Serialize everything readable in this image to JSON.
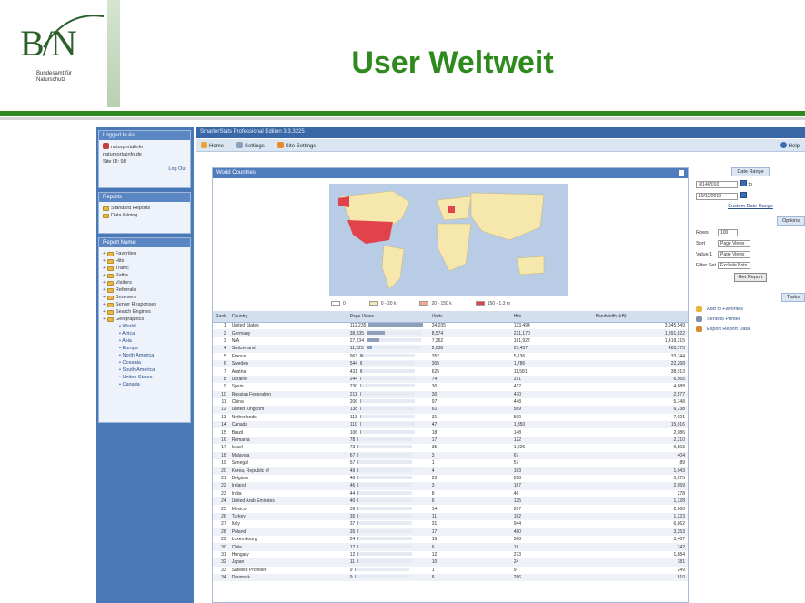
{
  "slide": {
    "title": "User Weltweit",
    "logo": {
      "mark": "B/N",
      "subtitle": "Bundesamt für Naturschutz"
    }
  },
  "app": {
    "window_title": "SmarterStats Professional Edition 3.3.3225",
    "toolbar": {
      "home": "Home",
      "settings": "Settings",
      "site_settings": "Site Settings",
      "help": "Help"
    }
  },
  "sidebar": {
    "login": {
      "title": "Logged In As",
      "user": "naturportalinfo",
      "domain": "naturportalinfo.de",
      "site": "Site ID: 98",
      "logout": "Log Out"
    },
    "reports": {
      "title": "Reports",
      "items": [
        "Standard Reports",
        "Data Mining"
      ]
    },
    "navigation": {
      "title": "Report Name",
      "folders": [
        "Favorites",
        "Hits",
        "Traffic",
        "Paths",
        "Visitors",
        "Referrals",
        "Browsers",
        "Server Responses",
        "Search Engines",
        "Geographics"
      ],
      "geo_items": [
        "World",
        "Africa",
        "Asia",
        "Europe",
        "North America",
        "Oceania",
        "South America",
        "United States",
        "Canada"
      ]
    }
  },
  "report": {
    "title": "World Countries",
    "legend": [
      "0",
      "0 - 20 k",
      "20 - 150 k",
      "150 - 1.3 m"
    ],
    "columns": [
      "Rank",
      "Country",
      "Page Views",
      "Visits",
      "Hits",
      "Bandwidth (kB)"
    ],
    "rows": [
      [
        "1",
        "United States",
        "112,235",
        "34,035",
        "133,494",
        "3,945,549"
      ],
      [
        "2",
        "Germany",
        "38,335",
        "8,574",
        "221,170",
        "1,891,622"
      ],
      [
        "3",
        "N/A",
        "27,234",
        "7,362",
        "181,927",
        "1,419,315"
      ],
      [
        "4",
        "Switzerland",
        "11,223",
        "2,038",
        "27,437",
        "483,773"
      ],
      [
        "5",
        "France",
        "963",
        "352",
        "5,136",
        "33,744"
      ],
      [
        "6",
        "Sweden",
        "544",
        "305",
        "1,786",
        "22,268"
      ],
      [
        "7",
        "Austria",
        "431",
        "625",
        "11,581",
        "38,913"
      ],
      [
        "8",
        "Ukraine",
        "244",
        "74",
        "291",
        "6,565"
      ],
      [
        "9",
        "Spain",
        "230",
        "30",
        "412",
        "4,888"
      ],
      [
        "10",
        "Russian Federation",
        "211",
        "30",
        "470",
        "2,577"
      ],
      [
        "11",
        "China",
        "206",
        "97",
        "448",
        "5,748"
      ],
      [
        "12",
        "United Kingdom",
        "138",
        "61",
        "569",
        "6,738"
      ],
      [
        "13",
        "Netherlands",
        "113",
        "31",
        "500",
        "7,021"
      ],
      [
        "14",
        "Canada",
        "110",
        "47",
        "1,350",
        "15,016"
      ],
      [
        "15",
        "Brazil",
        "106",
        "18",
        "148",
        "2,086"
      ],
      [
        "16",
        "Romania",
        "78",
        "17",
        "122",
        "2,310"
      ],
      [
        "17",
        "Israel",
        "73",
        "35",
        "1,226",
        "9,803"
      ],
      [
        "18",
        "Malaysia",
        "67",
        "3",
        "67",
        "404"
      ],
      [
        "19",
        "Senegal",
        "57",
        "1",
        "57",
        "89"
      ],
      [
        "20",
        "Korea, Republic of",
        "49",
        "4",
        "163",
        "1,043"
      ],
      [
        "21",
        "Belgium",
        "48",
        "23",
        "818",
        "5,675"
      ],
      [
        "22",
        "Ireland",
        "46",
        "3",
        "167",
        "2,659"
      ],
      [
        "23",
        "India",
        "44",
        "8",
        "46",
        "278"
      ],
      [
        "24",
        "United Arab Emirates",
        "40",
        "6",
        "125",
        "1,128"
      ],
      [
        "25",
        "Mexico",
        "39",
        "14",
        "207",
        "2,660"
      ],
      [
        "26",
        "Turkey",
        "35",
        "11",
        "162",
        "1,223"
      ],
      [
        "27",
        "Italy",
        "37",
        "31",
        "944",
        "6,862"
      ],
      [
        "28",
        "Poland",
        "35",
        "17",
        "480",
        "3,253"
      ],
      [
        "29",
        "Luxembourg",
        "24",
        "16",
        "968",
        "3,487"
      ],
      [
        "30",
        "Chile",
        "17",
        "6",
        "18",
        "142"
      ],
      [
        "31",
        "Hungary",
        "12",
        "12",
        "273",
        "1,884"
      ],
      [
        "32",
        "Japan",
        "11",
        "10",
        "24",
        "181"
      ],
      [
        "33",
        "Satellite Provider",
        "9",
        "1",
        "9",
        "249"
      ],
      [
        "34",
        "Denmark",
        "9",
        "6",
        "286",
        "810"
      ]
    ],
    "bar_fraction": [
      1.0,
      0.34,
      0.24,
      0.1,
      0.05,
      0.04,
      0.03,
      0.02,
      0.02,
      0.02,
      0.02,
      0.01,
      0.01,
      0.01,
      0.01,
      0.01,
      0.01,
      0.01,
      0.01,
      0.01,
      0.01,
      0.01,
      0.01,
      0.01,
      0.01,
      0.01,
      0.01,
      0.01,
      0.01,
      0.01,
      0.01,
      0.01,
      0.01,
      0.01
    ]
  },
  "right_panel": {
    "date_range": {
      "title": "Date Range",
      "from": "9/14/2010",
      "to": "10/13/2010",
      "to_label": "to",
      "custom": "Custom Date Range"
    },
    "options": {
      "title": "Options",
      "rows_label": "Rows",
      "rows_value": "100",
      "sort_label": "Sort",
      "sort_value": "Page Views",
      "value_label": "Value 1",
      "value_value": "Page Views",
      "filter_label": "Filter Set",
      "filter_value": "Exclude Bots",
      "button": "Get Report"
    },
    "tasks": {
      "title": "Tasks",
      "items": [
        "Add to Favorites",
        "Send to Printer",
        "Export Report Data"
      ]
    }
  },
  "colors": {
    "brand_green": "#2f8a1d",
    "app_blue": "#3a67a7",
    "map_high": "#e0434b",
    "map_mid": "#f6e7ad"
  }
}
